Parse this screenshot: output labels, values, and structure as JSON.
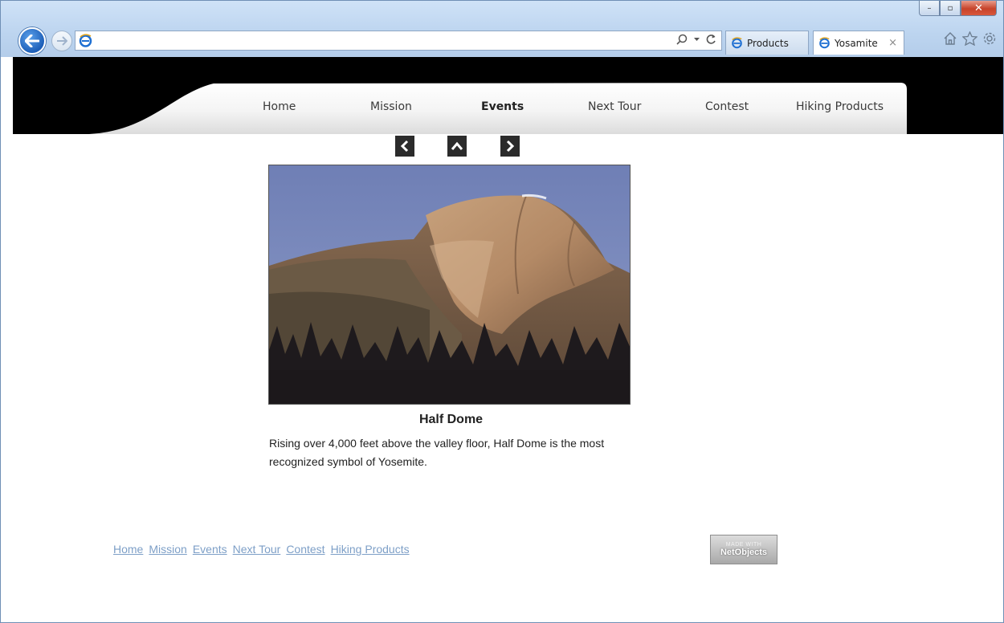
{
  "browser": {
    "tabs": [
      {
        "label": "Products",
        "active": false
      },
      {
        "label": "Yosamite",
        "active": true
      }
    ],
    "tab_close": "×",
    "window_controls": {
      "minimize": "–",
      "maximize": "▫",
      "close": "✕"
    },
    "address_icons": [
      "search-icon",
      "refresh-icon"
    ],
    "toolbar_icons": [
      "home-icon",
      "favorites-star-icon",
      "settings-gear-icon"
    ]
  },
  "nav": {
    "items": [
      "Home",
      "Mission",
      "Events",
      "Next Tour",
      "Contest",
      "Hiking Products"
    ],
    "current": "Events"
  },
  "slideshow": {
    "controls": [
      "previous-arrow-icon",
      "up-arrow-icon",
      "next-arrow-icon"
    ],
    "title": "Half Dome",
    "description": "Rising over 4,000 feet above the valley floor, Half Dome is the most recognized symbol of Yosemite."
  },
  "footer": {
    "links": [
      "Home",
      "Mission",
      "Events",
      "Next Tour",
      "Contest",
      "Hiking Products"
    ],
    "badge_small": "MADE WITH",
    "badge_big": "NetObjects"
  },
  "colors": {
    "header_bg": "#000000",
    "footer_link": "#7d9fc7",
    "control_bg": "#2b2b2b"
  }
}
